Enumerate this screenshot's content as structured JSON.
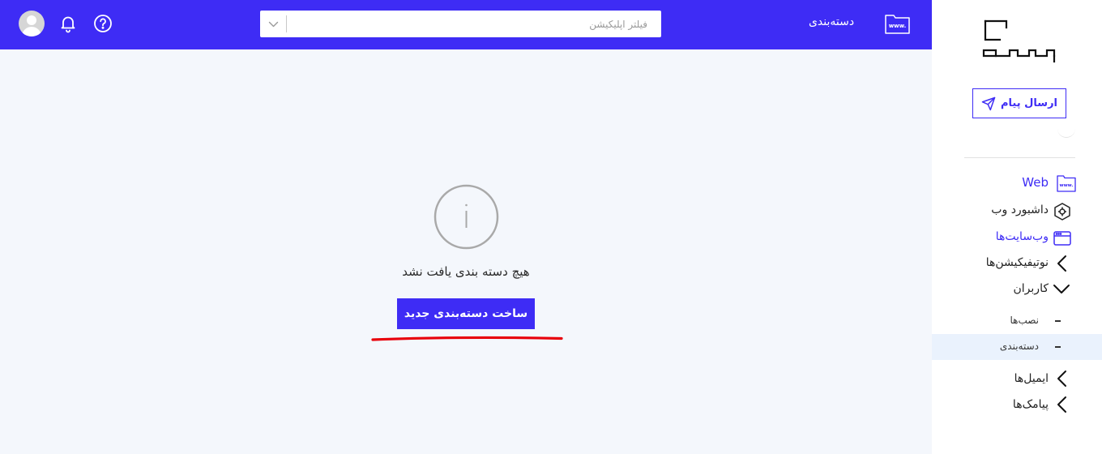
{
  "header": {
    "title": "دسته‌بندی",
    "search_placeholder": "فیلتر اپلیکیشن",
    "www_text": "www."
  },
  "sidebar": {
    "send_button_label": "ارسال پیام",
    "web_label": "Web",
    "items": [
      {
        "label": "داشبورد وب"
      },
      {
        "label": "وب‌سایت‌ها"
      },
      {
        "label": "نوتیفیکیشن‌ها"
      },
      {
        "label": "کاربران"
      }
    ],
    "subitems": [
      {
        "label": "نصب‌ها"
      },
      {
        "label": "دسته‌بندی"
      }
    ],
    "more_items": [
      {
        "label": "ایمیل‌ها"
      },
      {
        "label": "پیامک‌ها"
      }
    ]
  },
  "main": {
    "empty_message": "هیچ دسته بندی یافت نشد",
    "create_button_label": "ساخت دسته‌بندی جدید"
  },
  "colors": {
    "primary": "#3e2cf5",
    "annotation": "#e8000b",
    "background": "#f4f7fc",
    "active_row": "#eaf2fd"
  }
}
